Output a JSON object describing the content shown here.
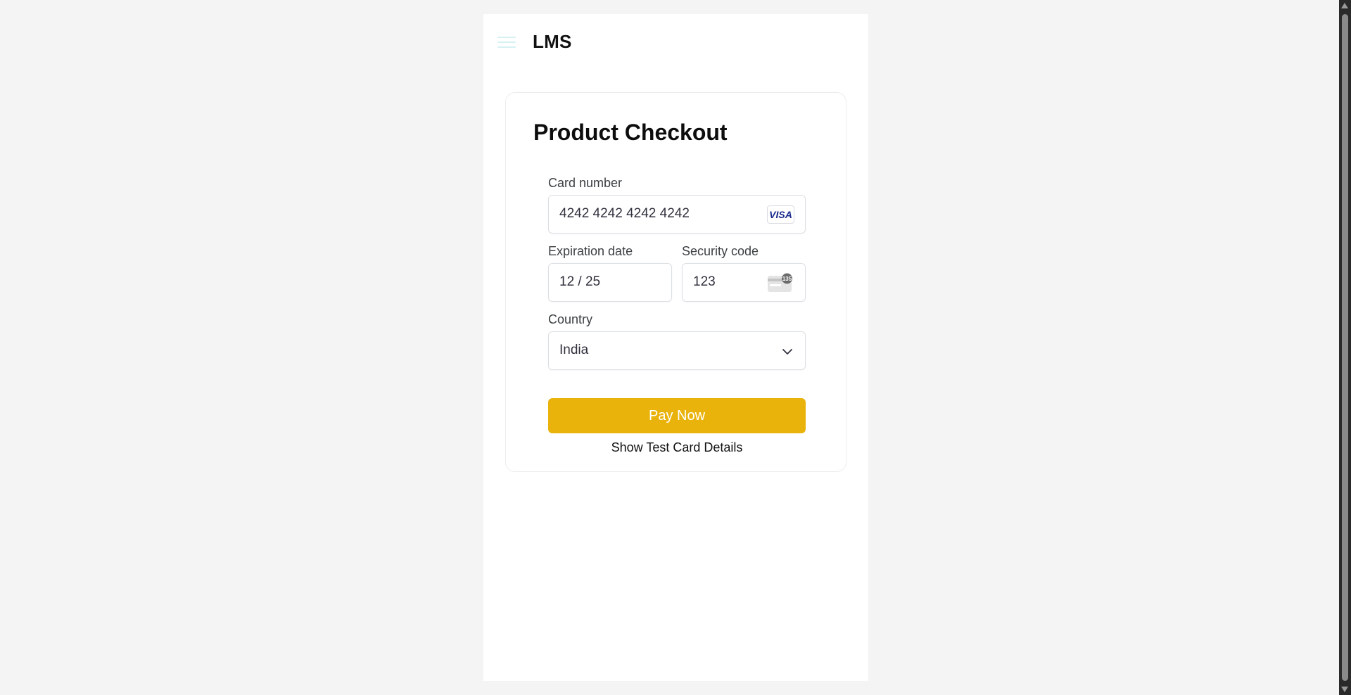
{
  "app": {
    "title": "LMS"
  },
  "checkout": {
    "title": "Product Checkout",
    "card_number": {
      "label": "Card number",
      "value": "4242 4242 4242 4242",
      "brand": "VISA"
    },
    "expiration": {
      "label": "Expiration date",
      "value": "12 / 25"
    },
    "security_code": {
      "label": "Security code",
      "value": "123",
      "icon_text": "135"
    },
    "country": {
      "label": "Country",
      "selected": "India"
    },
    "pay_button": "Pay Now",
    "test_card_link": "Show Test Card Details"
  },
  "colors": {
    "accent": "#e9b30b",
    "menu_icon": "#d7f1f2",
    "card_brand": "#1a2b8c"
  },
  "icons": [
    "hamburger-menu-icon",
    "visa-card-icon",
    "cvc-card-icon",
    "chevron-down-icon"
  ]
}
